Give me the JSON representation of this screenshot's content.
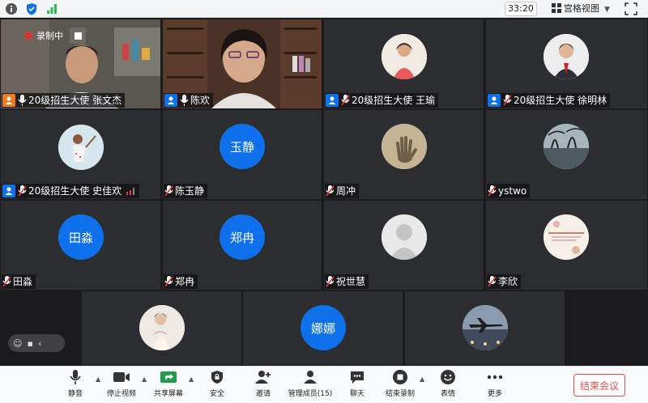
{
  "topbar": {
    "timer": "33:20",
    "grid_view_label": "宫格视图"
  },
  "recording": {
    "label": "录制中"
  },
  "participants": [
    {
      "name": "20级招生大使 张文杰",
      "avatar_text": "",
      "host": true,
      "host_color": "#f07a1c",
      "muted": false
    },
    {
      "name": "陈欢",
      "avatar_text": "",
      "host": true,
      "muted": false
    },
    {
      "name": "20级招生大使 王瑜",
      "avatar_text": "",
      "host": true,
      "muted": true
    },
    {
      "name": "20级招生大使 徐明林",
      "avatar_text": "",
      "host": true,
      "muted": true
    },
    {
      "name": "20级招生大使 史佳欢",
      "avatar_text": "",
      "host": true,
      "muted": true
    },
    {
      "name": "陈玉静",
      "avatar_text": "玉静",
      "host": false,
      "muted": true
    },
    {
      "name": "周冲",
      "avatar_text": "",
      "host": false,
      "muted": true
    },
    {
      "name": "ystwo",
      "avatar_text": "",
      "host": false,
      "muted": true
    },
    {
      "name": "田淼",
      "avatar_text": "田淼",
      "host": false,
      "muted": true
    },
    {
      "name": "郑冉",
      "avatar_text": "郑冉",
      "host": false,
      "muted": true
    },
    {
      "name": "祝世慧",
      "avatar_text": "",
      "host": false,
      "muted": true
    },
    {
      "name": "李欣",
      "avatar_text": "",
      "host": false,
      "muted": true
    },
    {
      "name": "",
      "avatar_text": "",
      "host": false,
      "muted": false
    },
    {
      "name": "",
      "avatar_text": "娜娜",
      "host": false,
      "muted": false
    },
    {
      "name": "",
      "avatar_text": "",
      "host": false,
      "muted": false
    }
  ],
  "toolbar": {
    "mute": "静音",
    "stop_video": "停止视频",
    "share_screen": "共享屏幕",
    "security": "安全",
    "invite": "邀请",
    "manage_members": "管理成员(15)",
    "chat": "聊天",
    "end_recording": "结束录制",
    "reactions": "表情",
    "more": "更多",
    "end_meeting": "结束会议"
  },
  "colors": {
    "accent": "#0e71eb",
    "danger": "#e0504c",
    "tile_bg": "#2c2d30"
  }
}
